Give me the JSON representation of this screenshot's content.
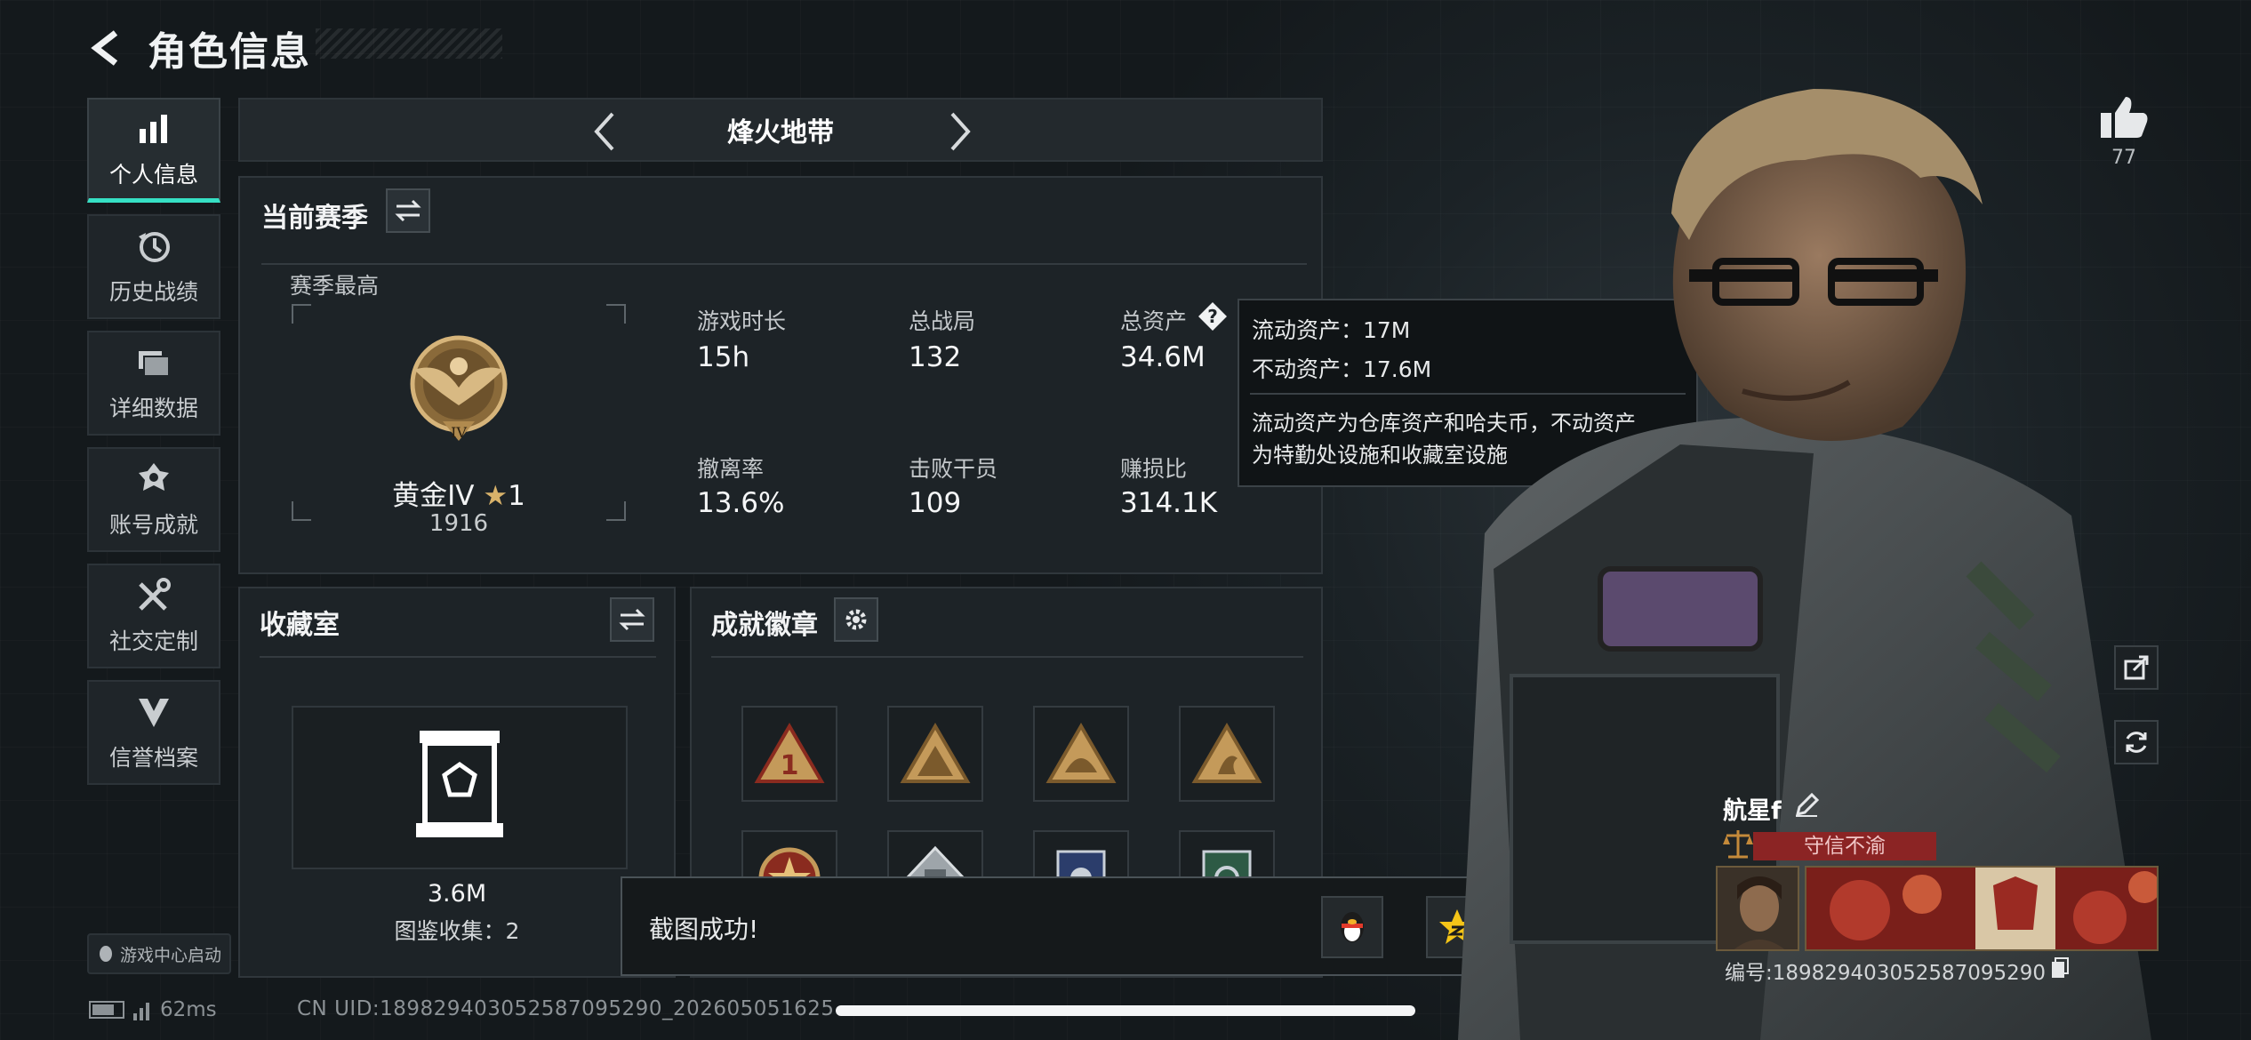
{
  "header": {
    "title": "角色信息",
    "back_icon": "back-arrow-icon"
  },
  "sidebar": {
    "items": [
      {
        "label": "个人信息",
        "icon": "bar-chart-icon",
        "active": true
      },
      {
        "label": "历史战绩",
        "icon": "history-clock-icon",
        "active": false
      },
      {
        "label": "详细数据",
        "icon": "folder-icon",
        "active": false
      },
      {
        "label": "账号成就",
        "icon": "achievement-icon",
        "active": false
      },
      {
        "label": "社交定制",
        "icon": "tools-icon",
        "active": false
      },
      {
        "label": "信誉档案",
        "icon": "reputation-icon",
        "active": false
      }
    ],
    "game_center_label": "游戏中心启动"
  },
  "mapnav": {
    "name": "烽火地带"
  },
  "season": {
    "title": "当前赛季",
    "best_label": "赛季最高",
    "rank_name": "黄金IV",
    "rank_stars": "1",
    "rank_score": "1916",
    "rank_numeral": "IV",
    "stats": [
      {
        "label": "游戏时长",
        "value": "15h"
      },
      {
        "label": "总战局",
        "value": "132"
      },
      {
        "label": "总资产",
        "value": "34.6M"
      },
      {
        "label": "撤离率",
        "value": "13.6%"
      },
      {
        "label": "击败干员",
        "value": "109"
      },
      {
        "label": "赚损比",
        "value": "314.1K"
      }
    ]
  },
  "tooltip": {
    "line1": "流动资产：17M",
    "line2": "不动资产：17.6M",
    "desc1": "流动资产为仓库资产和哈夫币，不动资产",
    "desc2": "为特勤处设施和收藏室设施"
  },
  "collection": {
    "title": "收藏室",
    "value": "3.6M",
    "count": "图鉴收集：2"
  },
  "achievements": {
    "title": "成就徽章"
  },
  "toast": {
    "message": "截图成功!"
  },
  "footer": {
    "ping": "62ms",
    "uid": "CN UID:18982940305258709529​0_202605051625"
  },
  "player": {
    "name": "航星f",
    "title_tag": "守信不渝",
    "id_text": "编号:189829403052587095290",
    "likes": "77"
  },
  "colors": {
    "accent": "#36e0c4",
    "title_tag": "#8b2424",
    "rank_gold": "#b08a4e"
  }
}
